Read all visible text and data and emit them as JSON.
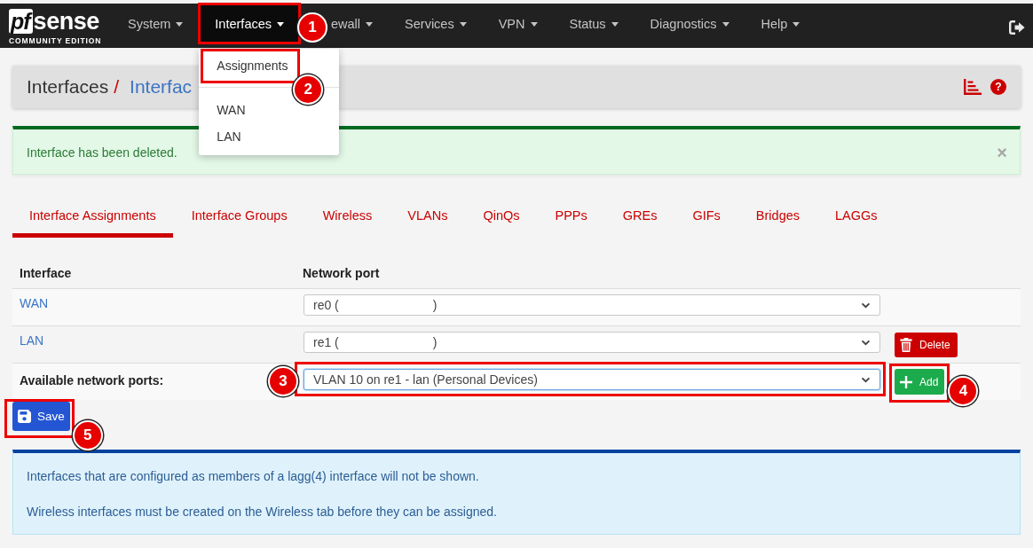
{
  "navbar": {
    "logo": {
      "mark": "pf",
      "word": "sense",
      "edition": "COMMUNITY EDITION"
    },
    "items": [
      {
        "label": "System",
        "expanded": false
      },
      {
        "label": "Interfaces",
        "expanded": true,
        "callout": "1",
        "menu": [
          {
            "kind": "item",
            "label": "Assignments",
            "callout": "2"
          },
          {
            "kind": "divider"
          },
          {
            "kind": "item",
            "label": "WAN"
          },
          {
            "kind": "item",
            "label": "LAN"
          }
        ]
      },
      {
        "label": "ewall",
        "expanded": false
      },
      {
        "label": "Services",
        "expanded": false
      },
      {
        "label": "VPN",
        "expanded": false
      },
      {
        "label": "Status",
        "expanded": false
      },
      {
        "label": "Diagnostics",
        "expanded": false
      },
      {
        "label": "Help",
        "expanded": false
      }
    ]
  },
  "header": {
    "crumbs": [
      {
        "label": "Interfaces",
        "link": false,
        "separator": "/"
      },
      {
        "label": "Interfac",
        "link": true
      }
    ],
    "help": "?"
  },
  "alert": {
    "message": "Interface has been deleted.",
    "close": "×"
  },
  "tabs": [
    {
      "label": "Interface Assignments",
      "selected": true
    },
    {
      "label": "Interface Groups",
      "selected": false
    },
    {
      "label": "Wireless",
      "selected": false
    },
    {
      "label": "VLANs",
      "selected": false
    },
    {
      "label": "QinQs",
      "selected": false
    },
    {
      "label": "PPPs",
      "selected": false
    },
    {
      "label": "GREs",
      "selected": false
    },
    {
      "label": "GIFs",
      "selected": false
    },
    {
      "label": "Bridges",
      "selected": false
    },
    {
      "label": "LAGGs",
      "selected": false
    }
  ],
  "table": {
    "columns": [
      "Interface",
      "Network port"
    ],
    "rows": [
      {
        "interface": "WAN",
        "port_start": "re0 (",
        "port_end": ")"
      },
      {
        "interface": "LAN",
        "port_start": "re1 (",
        "port_end": ")",
        "action": "Delete"
      }
    ],
    "available": {
      "label": "Available network ports:",
      "value": "VLAN 10 on re1 - lan (Personal Devices)",
      "focused": true,
      "callout": "3",
      "button": {
        "label": "Add",
        "callout": "4"
      }
    }
  },
  "save": {
    "label": "Save",
    "callout": "5"
  },
  "info": [
    "Interfaces that are configured as members of a lagg(4) interface will not be shown.",
    "Wireless interfaces must be created on the Wireless tab before they can be assigned."
  ]
}
